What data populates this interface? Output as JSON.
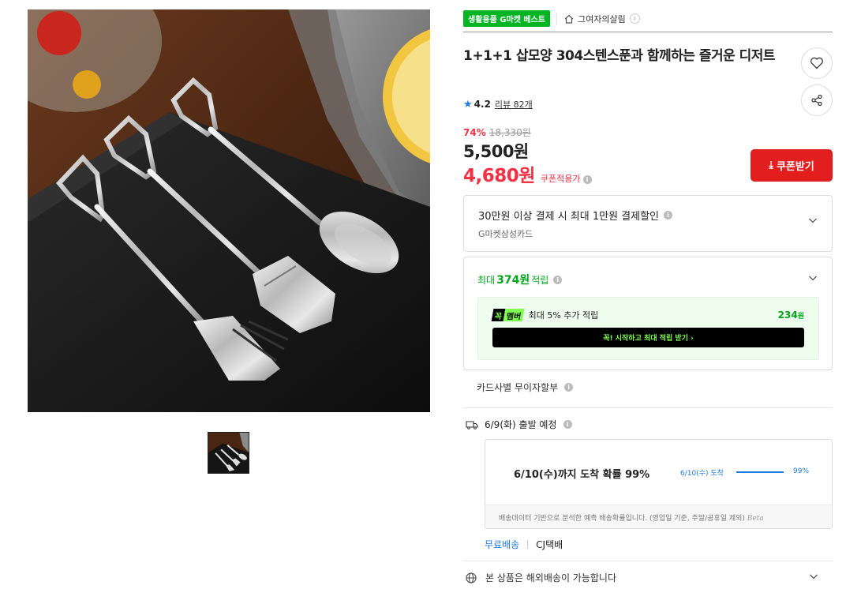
{
  "header": {
    "badge": "생활용품 G마켓 베스트",
    "store_name": "그여자의살림"
  },
  "product": {
    "title": "1+1+1 삽모양 304스텐스푼과 함께하는 즐거운 디저트",
    "rating": "4.2",
    "review_label": "리뷰 82개",
    "discount_rate": "74%",
    "original_price": "18,330원",
    "price": "5,500원",
    "coupon_price": "4,680원",
    "coupon_applied_label": "쿠폰적용가"
  },
  "buttons": {
    "coupon": "쿠폰받기"
  },
  "card_benefit": {
    "title": "30만원 이상 결제 시 최대 1만원 결제할인",
    "card_name": "G마켓삼성카드"
  },
  "points": {
    "prefix": "최대",
    "amount": "374원",
    "suffix": "적립",
    "member_logo_a": "꼭",
    "member_logo_b": "멤버",
    "member_text": "최대 5% 추가 적립",
    "member_amount": "234",
    "member_unit": "원",
    "member_cta": "꼭! 시작하고 최대 적립 받기 ›"
  },
  "installment": {
    "label": "카드사별 무이자할부"
  },
  "shipping": {
    "departure": "6/9(화) 출발 예정",
    "arrival_big": "6/10(수)까지 도착 확률 99%",
    "arrival_small": "6/10(수) 도착",
    "arrival_pct": "99%",
    "arrival_probability": 0.99,
    "footnote": "배송데이터 기반으로 분석한 예측 배송확률입니다. (영업일 기준, 주말/공휴일 제외)",
    "beta": "Beta",
    "free_label": "무료배송",
    "carrier": "CJ택배"
  },
  "overseas": {
    "label": "본 상품은 해외배송이 가능합니다"
  },
  "colors": {
    "accent_red": "#e21e1e",
    "discount_red": "#f43142",
    "point_green": "#00a61c",
    "badge_green": "#00b523",
    "link_blue": "#1f7ae0"
  },
  "icons": {
    "like": "heart-icon",
    "share": "share-icon",
    "home": "home-icon",
    "star": "star-icon",
    "download": "download-icon",
    "truck": "truck-icon",
    "globe": "globe-icon"
  }
}
